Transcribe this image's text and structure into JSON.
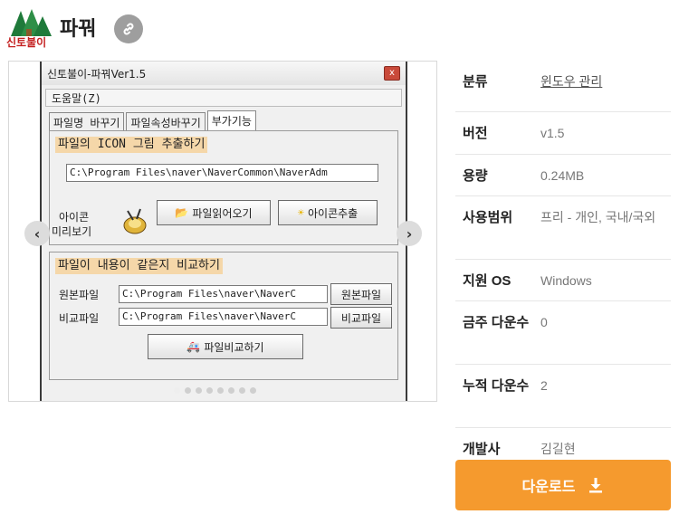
{
  "app": {
    "logo_text": "신토불이",
    "title": "파꿔"
  },
  "screenshot_window": {
    "title": "신토불이-파꿔Ver1.5",
    "close": "x",
    "menu_help": "도움말(Z)",
    "tabs": [
      "파일명 바꾸기",
      "파일속성바꾸기",
      "부가기능"
    ],
    "icon_section": {
      "heading": "파일의 ICON 그림 추출하기",
      "path": "C:\\Program Files\\naver\\NaverCommon\\NaverAdm",
      "preview_label_1": "아이콘",
      "preview_label_2": "미리보기",
      "read_file_button": "파일읽어오기",
      "extract_button": "아이콘추출"
    },
    "compare_section": {
      "heading": "파일이 내용이 같은지 비교하기",
      "original_label": "원본파일",
      "original_path": "C:\\Program Files\\naver\\NaverC",
      "original_button": "원본파일",
      "compare_label": "비교파일",
      "compare_path": "C:\\Program Files\\naver\\NaverC",
      "compare_button": "비교파일",
      "compare_run_button": "파일비교하기"
    }
  },
  "carousel": {
    "dot_count": 8,
    "active_index": 0
  },
  "spec": [
    {
      "key": "분류",
      "value": "윈도우 관리"
    },
    {
      "key": "버전",
      "value": "v1.5"
    },
    {
      "key": "용량",
      "value": "0.24MB"
    },
    {
      "key": "사용범위",
      "value": "프리 - 개인, 국내/국외"
    },
    {
      "key": "지원 OS",
      "value": "Windows"
    },
    {
      "key": "금주 다운수",
      "value": "0"
    },
    {
      "key": "누적 다운수",
      "value": "2"
    },
    {
      "key": "개발사",
      "value": "김길현"
    }
  ],
  "download_label": "다운로드",
  "colors": {
    "accent": "#f59a2e",
    "section_head": "#f5d7a9"
  }
}
